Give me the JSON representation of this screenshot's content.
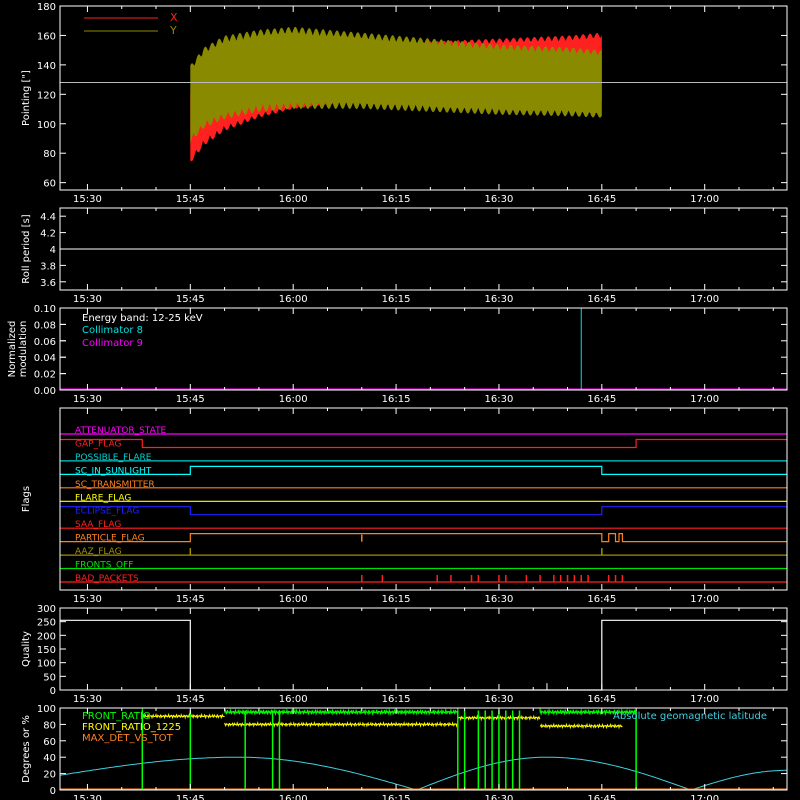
{
  "chart_data": [
    {
      "type": "area",
      "ylabel": "Pointing [\"]",
      "xlim": [
        "15:26",
        "17:12"
      ],
      "ylim": [
        55,
        180
      ],
      "yticks": [
        60,
        80,
        100,
        120,
        140,
        160,
        180
      ],
      "xticks": [
        "15:30",
        "15:45",
        "16:00",
        "16:15",
        "16:30",
        "16:45",
        "17:00"
      ],
      "reference_line": 128,
      "data_start": "15:45",
      "data_end": "16:45",
      "legend_placement": "top-left",
      "series": [
        {
          "name": "X",
          "color": "#ff2020",
          "x": [
            "15:45",
            "15:47",
            "15:50",
            "15:55",
            "16:00",
            "16:10",
            "16:20",
            "16:30",
            "16:40",
            "16:45"
          ],
          "upper": [
            125,
            135,
            140,
            142,
            146,
            150,
            156,
            158,
            160,
            162
          ],
          "lower": [
            73,
            85,
            95,
            104,
            110,
            116,
            120,
            119,
            117,
            115
          ]
        },
        {
          "name": "Y",
          "color": "#8a8a00",
          "x": [
            "15:45",
            "15:47",
            "15:50",
            "15:55",
            "16:00",
            "16:10",
            "16:20",
            "16:30",
            "16:40",
            "16:45"
          ],
          "upper": [
            140,
            152,
            160,
            164,
            166,
            162,
            158,
            154,
            152,
            150
          ],
          "lower": [
            87,
            97,
            103,
            108,
            110,
            110,
            108,
            106,
            105,
            104
          ]
        }
      ]
    },
    {
      "type": "line",
      "ylabel": "Roll period [s]",
      "xlim": [
        "15:26",
        "17:12"
      ],
      "ylim": [
        3.5,
        4.5
      ],
      "yticks": [
        3.6,
        3.8,
        4.0,
        4.2,
        4.4
      ],
      "xticks": [
        "15:30",
        "15:45",
        "16:00",
        "16:15",
        "16:30",
        "16:45",
        "17:00"
      ],
      "series": [
        {
          "color": "#ffffff",
          "x": [
            "15:26",
            "17:12"
          ],
          "y": [
            4.0,
            4.0
          ]
        }
      ]
    },
    {
      "type": "line",
      "ylabel": [
        "Normalized",
        "modulation"
      ],
      "xlim": [
        "15:26",
        "17:12"
      ],
      "ylim": [
        0.0,
        0.1
      ],
      "yticks": [
        "0.00",
        "0.02",
        "0.04",
        "0.06",
        "0.08",
        "0.10"
      ],
      "xticks": [
        "15:30",
        "15:45",
        "16:00",
        "16:15",
        "16:30",
        "16:45",
        "17:00"
      ],
      "annotation": "Energy band: 12-25 keV",
      "series": [
        {
          "name": "Collimator 8",
          "color": "#00e0e0",
          "spike_at": "16:42",
          "spike_value": 0.1
        },
        {
          "name": "Collimator 9",
          "color": "#ff00ff",
          "x": [
            "15:26",
            "17:12"
          ],
          "y": [
            0.0,
            0.0
          ]
        }
      ]
    },
    {
      "type": "line",
      "ylabel": "Flags",
      "xlim": [
        "15:26",
        "17:12"
      ],
      "xticks": [
        "15:30",
        "15:45",
        "16:00",
        "16:15",
        "16:30",
        "16:45",
        "17:00"
      ],
      "flags": [
        {
          "name": "ATTENUATOR_STATE",
          "color": "#ff00ff",
          "steps": [
            [
              "15:26",
              0
            ],
            [
              "17:12",
              0
            ]
          ]
        },
        {
          "name": "GAP_FLAG",
          "color": "#ff2020",
          "steps": [
            [
              "15:26",
              1
            ],
            [
              "15:38",
              0
            ],
            [
              "16:50",
              1
            ],
            [
              "17:12",
              1
            ]
          ]
        },
        {
          "name": "POSSIBLE_FLARE",
          "color": "#00d0d0",
          "steps": [
            [
              "15:26",
              0
            ],
            [
              "17:12",
              0
            ]
          ]
        },
        {
          "name": "SC_IN_SUNLIGHT",
          "color": "#00ffff",
          "steps": [
            [
              "15:26",
              0
            ],
            [
              "15:45",
              1
            ],
            [
              "16:45",
              0
            ],
            [
              "17:12",
              0
            ]
          ]
        },
        {
          "name": "SC_TRANSMITTER",
          "color": "#ff8020",
          "steps": [
            [
              "15:26",
              0
            ],
            [
              "17:12",
              0
            ]
          ]
        },
        {
          "name": "FLARE_FLAG",
          "color": "#ffff00",
          "steps": [
            [
              "15:26",
              0
            ],
            [
              "17:12",
              0
            ]
          ]
        },
        {
          "name": "ECLIPSE_FLAG",
          "color": "#2020ff",
          "steps": [
            [
              "15:26",
              1
            ],
            [
              "15:45",
              0
            ],
            [
              "16:45",
              1
            ],
            [
              "17:12",
              1
            ]
          ]
        },
        {
          "name": "SAA_FLAG",
          "color": "#ff2020",
          "steps": [
            [
              "15:26",
              0
            ],
            [
              "17:12",
              0
            ]
          ]
        },
        {
          "name": "PARTICLE_FLAG",
          "color": "#ff8020",
          "steps": [
            [
              "15:26",
              0
            ],
            [
              "15:45",
              1
            ],
            [
              "16:45",
              0
            ],
            [
              "16:46",
              1
            ],
            [
              "16:47",
              0
            ],
            [
              "16:47.5",
              1
            ],
            [
              "16:48",
              0
            ],
            [
              "17:12",
              0
            ]
          ],
          "spikes": [
            "16:10"
          ]
        },
        {
          "name": "AAZ_FLAG",
          "color": "#a09000",
          "steps": [
            [
              "15:26",
              0
            ],
            [
              "17:12",
              0
            ]
          ],
          "spikes": [
            "15:45",
            "16:45"
          ]
        },
        {
          "name": "FRONTS_OFF",
          "color": "#00e000",
          "steps": [
            [
              "15:26",
              0
            ],
            [
              "17:12",
              0
            ]
          ]
        },
        {
          "name": "BAD_PACKETS",
          "color": "#ff2020",
          "steps": [
            [
              "15:26",
              0
            ],
            [
              "17:12",
              0
            ]
          ],
          "spikes": [
            "16:10",
            "16:13",
            "16:21",
            "16:23",
            "16:26",
            "16:27",
            "16:30",
            "16:31",
            "16:34",
            "16:36",
            "16:38",
            "16:39",
            "16:40",
            "16:41",
            "16:42",
            "16:43",
            "16:46",
            "16:47",
            "16:48"
          ]
        }
      ]
    },
    {
      "type": "line",
      "ylabel": "Quality",
      "xlim": [
        "15:26",
        "17:12"
      ],
      "ylim": [
        0,
        300
      ],
      "yticks": [
        0,
        50,
        100,
        150,
        200,
        250,
        300
      ],
      "xticks": [
        "15:30",
        "15:45",
        "16:00",
        "16:15",
        "16:30",
        "16:45",
        "17:00"
      ],
      "series": [
        {
          "color": "#ffffff",
          "x": [
            "15:26",
            "15:45",
            "15:45",
            "16:45",
            "16:45",
            "17:12"
          ],
          "y": [
            255,
            255,
            0,
            0,
            255,
            255
          ],
          "spikes": [
            [
              "16:37",
              25
            ]
          ]
        }
      ]
    },
    {
      "type": "line",
      "ylabel": "Degrees or %",
      "xlim": [
        "15:26",
        "17:12"
      ],
      "ylim": [
        0,
        100
      ],
      "yticks": [
        0,
        20,
        40,
        60,
        80,
        100
      ],
      "xticks": [
        "15:30",
        "15:45",
        "16:00",
        "16:15",
        "16:30",
        "16:45",
        "17:00"
      ],
      "legend_placement": "top-left",
      "right_legend": "Absolute geomagnetic latitude",
      "series": [
        {
          "name": "FRONT_RATIO",
          "color": "#00ff00",
          "x": [
            "15:26",
            "15:38",
            "15:38",
            "15:50",
            "15:50",
            "16:00",
            "16:00",
            "16:24",
            "16:24",
            "16:36",
            "16:36",
            "16:50",
            "16:50",
            "17:12"
          ],
          "y": [
            0,
            0,
            100,
            100,
            95,
            95,
            95,
            95,
            100,
            100,
            95,
            95,
            0,
            0
          ],
          "dropouts": [
            "15:38",
            "15:45",
            "15:53",
            "15:57",
            "15:58",
            "16:24",
            "16:25",
            "16:27",
            "16:28",
            "16:29",
            "16:30",
            "16:31",
            "16:32",
            "16:33",
            "16:50"
          ]
        },
        {
          "name": "FRONT_RATIO_1225",
          "color": "#ffff00",
          "x": [
            "15:38",
            "15:50",
            "15:50",
            "16:24",
            "16:24",
            "16:36",
            "16:36",
            "16:48"
          ],
          "y": [
            90,
            90,
            80,
            80,
            88,
            88,
            78,
            78
          ]
        },
        {
          "name": "MAX_DET_VS_TOT",
          "color": "#ff8020",
          "x": [
            "15:26",
            "17:12"
          ],
          "y": [
            0,
            0
          ]
        },
        {
          "name": "Absolute geomagnetic latitude",
          "color": "#40d0e0",
          "x": [
            "15:26",
            "15:52",
            "16:18",
            "16:37",
            "16:58",
            "17:12"
          ],
          "y": [
            18,
            40,
            0,
            40,
            0,
            24
          ]
        }
      ]
    }
  ]
}
